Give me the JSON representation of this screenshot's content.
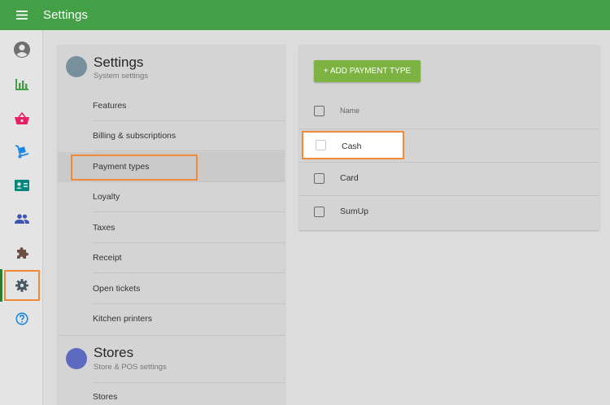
{
  "app": {
    "title": "Settings"
  },
  "icons": {
    "menu": "menu-icon",
    "account": "account-circle-icon",
    "reports": "bar-chart-icon",
    "items": "basket-icon",
    "inventory": "dolly-icon",
    "employees": "badge-card-icon",
    "customers": "people-icon",
    "integrations": "puzzle-icon",
    "settings": "gear-icon",
    "help": "help-circle-icon"
  },
  "colors": {
    "topbar": "#43a047",
    "reports": "#43a047",
    "items": "#e91e63",
    "inventory": "#1e88e5",
    "employees": "#00897b",
    "customers": "#3f51b5",
    "integrations": "#6d4c41",
    "settings": "#455a64",
    "help": "#1e88e5",
    "highlight": "#ef8a3b",
    "add_button": "#7cb342"
  },
  "settings_section": {
    "title": "Settings",
    "subtitle": "System settings",
    "items": [
      {
        "label": "Features"
      },
      {
        "label": "Billing & subscriptions"
      },
      {
        "label": "Payment types"
      },
      {
        "label": "Loyalty"
      },
      {
        "label": "Taxes"
      },
      {
        "label": "Receipt"
      },
      {
        "label": "Open tickets"
      },
      {
        "label": "Kitchen printers"
      }
    ]
  },
  "stores_section": {
    "title": "Stores",
    "subtitle": "Store & POS settings",
    "items": [
      {
        "label": "Stores"
      }
    ]
  },
  "payment_types": {
    "add_button_label": "+ ADD PAYMENT TYPE",
    "column_name": "Name",
    "rows": [
      {
        "name": "Cash"
      },
      {
        "name": "Card"
      },
      {
        "name": "SumUp"
      }
    ]
  }
}
